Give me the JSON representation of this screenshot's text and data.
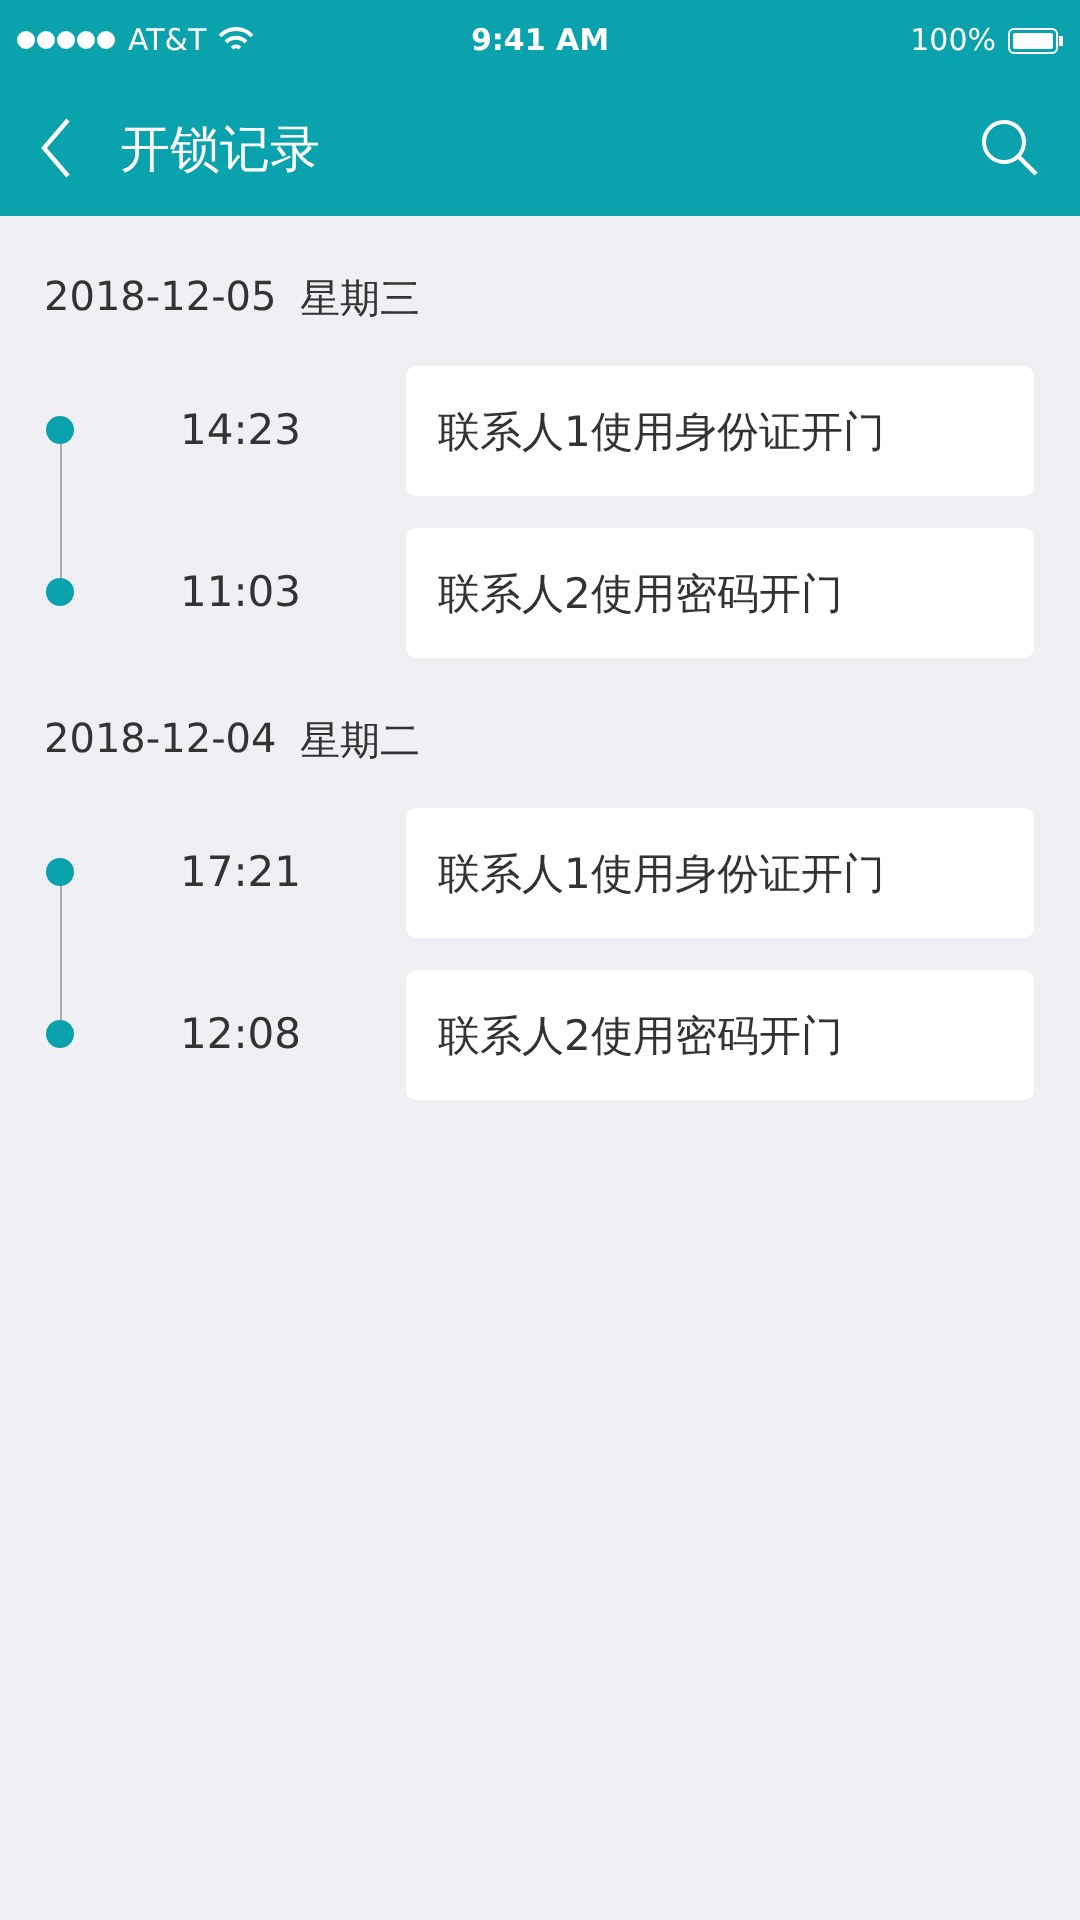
{
  "status_bar": {
    "carrier": "AT&T",
    "time": "9:41 AM",
    "battery": "100%"
  },
  "header": {
    "title": "开锁记录"
  },
  "days": [
    {
      "date": "2018-12-05",
      "weekday": "星期三",
      "records": [
        {
          "time": "14:23",
          "text": "联系人1使用身份证开门"
        },
        {
          "time": "11:03",
          "text": "联系人2使用密码开门"
        }
      ]
    },
    {
      "date": "2018-12-04",
      "weekday": "星期二",
      "records": [
        {
          "time": "17:21",
          "text": "联系人1使用身份证开门"
        },
        {
          "time": "12:08",
          "text": "联系人2使用密码开门"
        }
      ]
    }
  ]
}
